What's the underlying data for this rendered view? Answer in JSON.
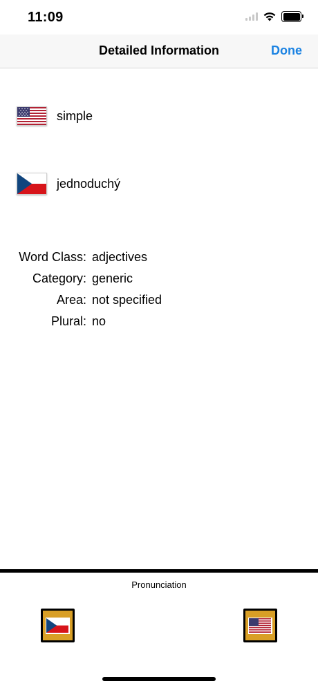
{
  "status_bar": {
    "time": "11:09",
    "icons": [
      "signal-icon",
      "wifi-icon",
      "battery-icon"
    ]
  },
  "nav": {
    "title": "Detailed Information",
    "done_label": "Done",
    "accent_color": "#1a82e2"
  },
  "words": [
    {
      "flag": "us-flag-icon",
      "text": "simple"
    },
    {
      "flag": "czech-flag-icon",
      "text": "jednoduchý"
    }
  ],
  "details": [
    {
      "label": "Word Class:",
      "value": "adjectives"
    },
    {
      "label": "Category:",
      "value": "generic"
    },
    {
      "label": "Area:",
      "value": "not specified"
    },
    {
      "label": "Plural:",
      "value": "no"
    }
  ],
  "pronunciation": {
    "label": "Pronunciation",
    "buttons": [
      {
        "flag": "czech-flag-icon"
      },
      {
        "flag": "us-flag-icon"
      }
    ],
    "button_color": "#d99f26"
  }
}
